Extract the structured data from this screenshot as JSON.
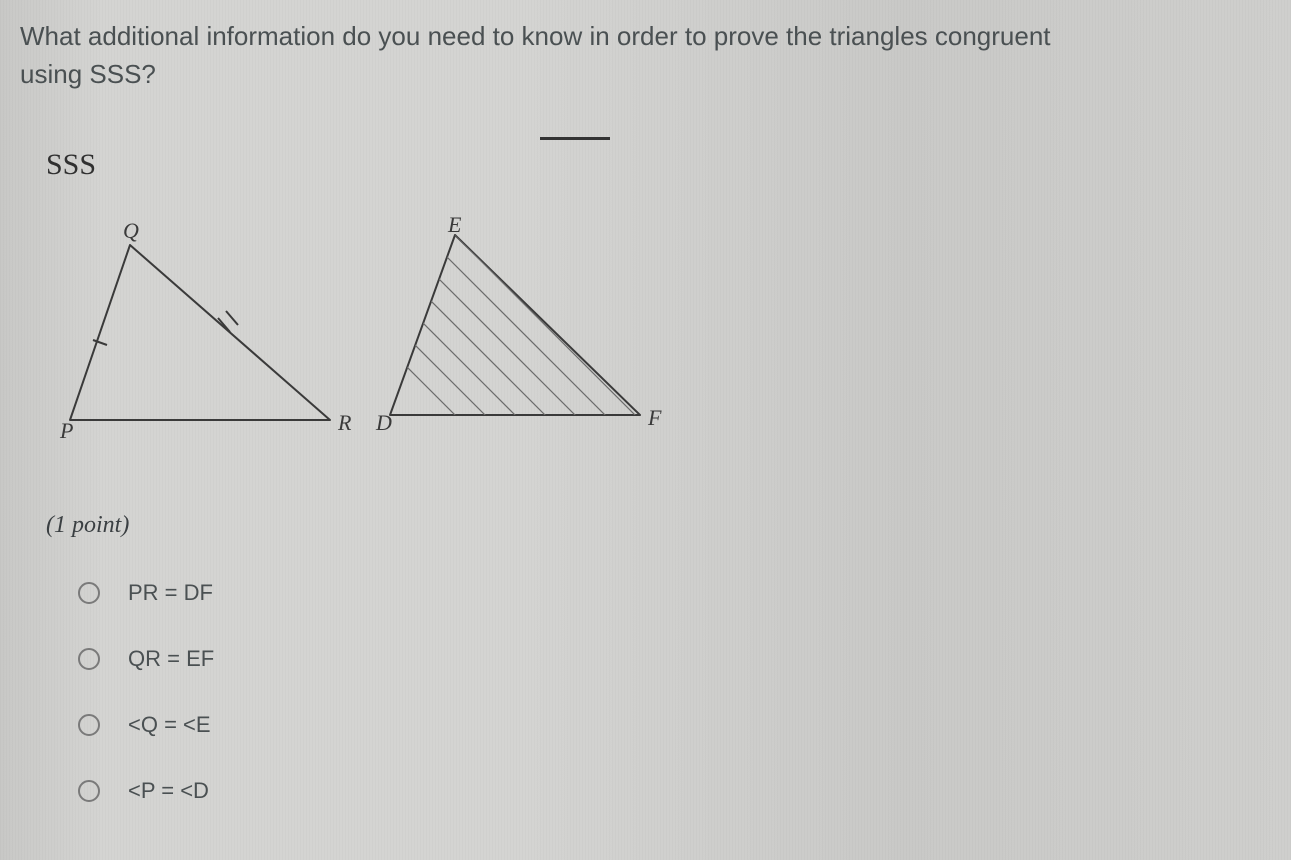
{
  "question": "What additional information do you need to know in order to prove the triangles congruent using SSS?",
  "theorem_label": "SSS",
  "triangleA": {
    "P": "P",
    "Q": "Q",
    "R": "R"
  },
  "triangleB": {
    "D": "D",
    "E": "E",
    "F": "F"
  },
  "points_label": "(1 point)",
  "choices": {
    "a": "PR = DF",
    "b": "QR = EF",
    "c": "<Q = <E",
    "d": "<P = <D"
  }
}
